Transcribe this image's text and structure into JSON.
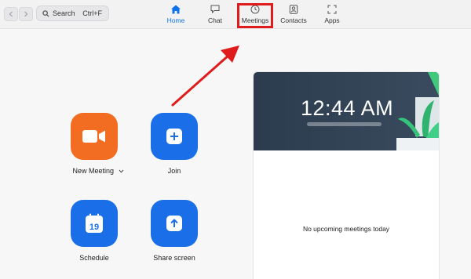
{
  "search": {
    "label": "Search",
    "shortcut": "Ctrl+F"
  },
  "tabs": [
    {
      "label": "Home",
      "icon": "home-icon",
      "active": true
    },
    {
      "label": "Chat",
      "icon": "chat-icon",
      "active": false
    },
    {
      "label": "Meetings",
      "icon": "clock-icon",
      "active": false
    },
    {
      "label": "Contacts",
      "icon": "contacts-icon",
      "active": false
    },
    {
      "label": "Apps",
      "icon": "apps-icon",
      "active": false
    }
  ],
  "actions": [
    {
      "label": "New Meeting",
      "icon": "video-camera-icon",
      "color": "#f26d21"
    },
    {
      "label": "Join",
      "icon": "plus-icon",
      "color": "#1a6fe8"
    },
    {
      "label": "Schedule",
      "icon": "calendar-icon",
      "color": "#1a6fe8",
      "calendar_day": "19"
    },
    {
      "label": "Share screen",
      "icon": "share-upload-icon",
      "color": "#1a6fe8"
    }
  ],
  "meetings_panel": {
    "time": "12:44 AM",
    "empty_message": "No upcoming meetings today"
  },
  "colors": {
    "accent": "#0e72ed",
    "highlight": "#e01b1b",
    "panel_header": "#2c3c4e"
  }
}
